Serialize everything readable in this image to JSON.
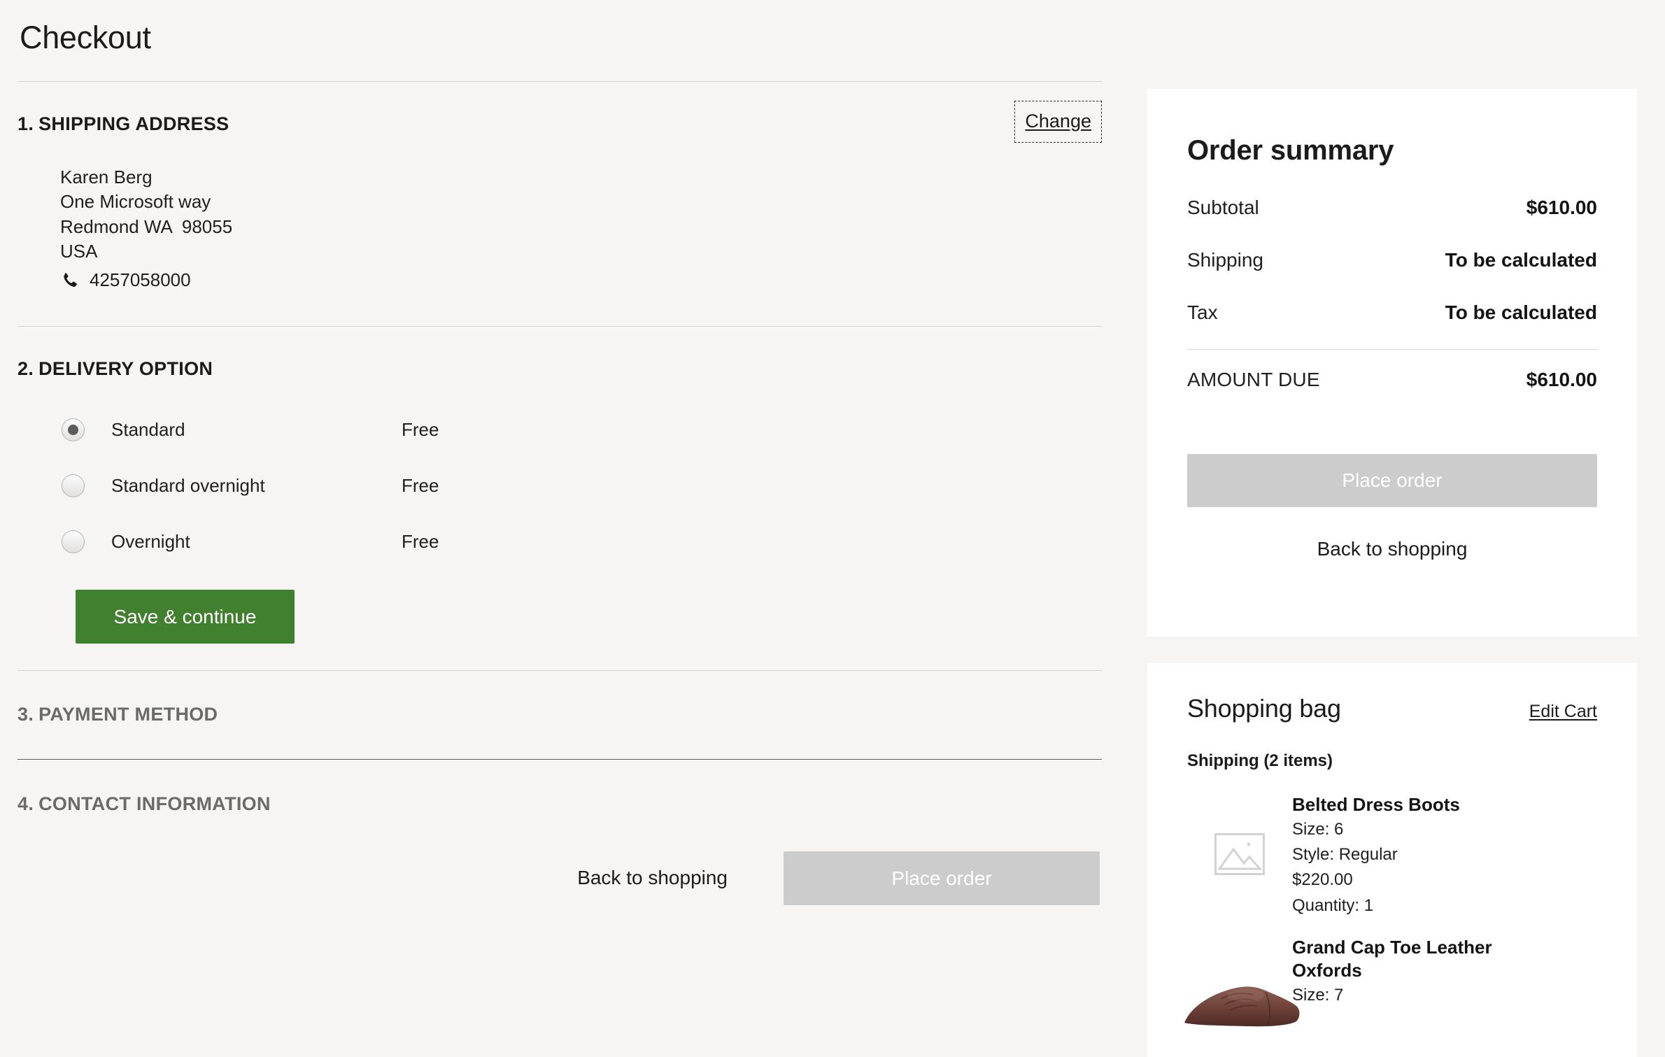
{
  "page": {
    "title": "Checkout",
    "background_color": "#f6f5f3"
  },
  "sections": {
    "shipping": {
      "number": "1.",
      "heading": "SHIPPING ADDRESS",
      "change_label": "Change",
      "address": {
        "name": "Karen Berg",
        "street": "One Microsoft way",
        "city_state_zip": "Redmond WA  98055",
        "country": "USA",
        "phone": "4257058000",
        "phone_icon": "phone-icon"
      }
    },
    "delivery": {
      "number": "2.",
      "heading": "DELIVERY OPTION",
      "options": [
        {
          "label": "Standard",
          "price": "Free",
          "selected": true
        },
        {
          "label": "Standard overnight",
          "price": "Free",
          "selected": false
        },
        {
          "label": "Overnight",
          "price": "Free",
          "selected": false
        }
      ],
      "save_label": "Save & continue",
      "save_color": "#41802f"
    },
    "payment": {
      "number": "3.",
      "heading": "PAYMENT METHOD"
    },
    "contact": {
      "number": "4.",
      "heading": "CONTACT INFORMATION"
    }
  },
  "bottom_actions": {
    "back_label": "Back to shopping",
    "place_order_label": "Place order",
    "place_order_disabled_color": "#cccccc"
  },
  "order_summary": {
    "title": "Order summary",
    "rows": [
      {
        "label": "Subtotal",
        "value": "$610.00"
      },
      {
        "label": "Shipping",
        "value": "To be calculated"
      },
      {
        "label": "Tax",
        "value": "To be calculated"
      }
    ],
    "total": {
      "label": "AMOUNT DUE",
      "value": "$610.00"
    },
    "place_order_label": "Place order",
    "back_label": "Back to shopping"
  },
  "shopping_bag": {
    "title": "Shopping bag",
    "edit_label": "Edit Cart",
    "group_label": "Shipping (2 items)",
    "items": [
      {
        "name": "Belted Dress Boots",
        "size": "Size: 6",
        "style": "Style: Regular",
        "price": "$220.00",
        "quantity": "Quantity: 1",
        "thumb": "image-placeholder-icon"
      },
      {
        "name": "Grand Cap Toe Leather Oxfords",
        "size": "Size: 7",
        "thumb": "oxford-shoe-photo"
      }
    ]
  }
}
